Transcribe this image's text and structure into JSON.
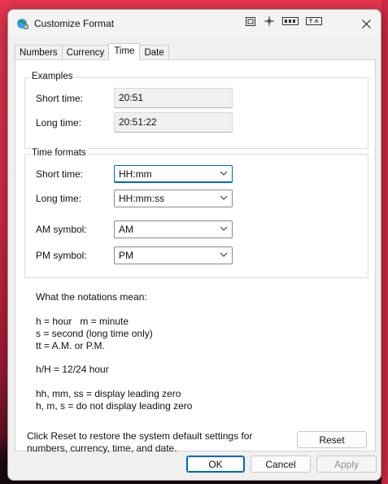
{
  "window": {
    "title": "Customize Format"
  },
  "tabs": [
    {
      "label": "Numbers"
    },
    {
      "label": "Currency"
    },
    {
      "label": "Time"
    },
    {
      "label": "Date"
    }
  ],
  "examples": {
    "heading": "Examples",
    "short_label": "Short time:",
    "short_value": "20:51",
    "long_label": "Long time:",
    "long_value": "20:51:22"
  },
  "formats": {
    "heading": "Time formats",
    "short_label": "Short time:",
    "short_value": "HH:mm",
    "long_label": "Long time:",
    "long_value": "HH:mm:ss",
    "am_label": "AM symbol:",
    "am_value": "AM",
    "pm_label": "PM symbol:",
    "pm_value": "PM"
  },
  "notations": {
    "heading": "What the notations mean:",
    "line1": "h = hour   m = minute",
    "line2": "s = second (long time only)",
    "line3": "tt = A.M. or P.M.",
    "line4": "h/H = 12/24 hour",
    "line5": "hh, mm, ss = display leading zero",
    "line6": "h, m, s = do not display leading zero"
  },
  "reset": {
    "text": "Click Reset to restore the system default settings for numbers, currency, time, and date.",
    "button": "Reset"
  },
  "footer": {
    "ok": "OK",
    "cancel": "Cancel",
    "apply": "Apply"
  },
  "colors": {
    "accent": "#0067c0",
    "background": "#e8354d"
  }
}
